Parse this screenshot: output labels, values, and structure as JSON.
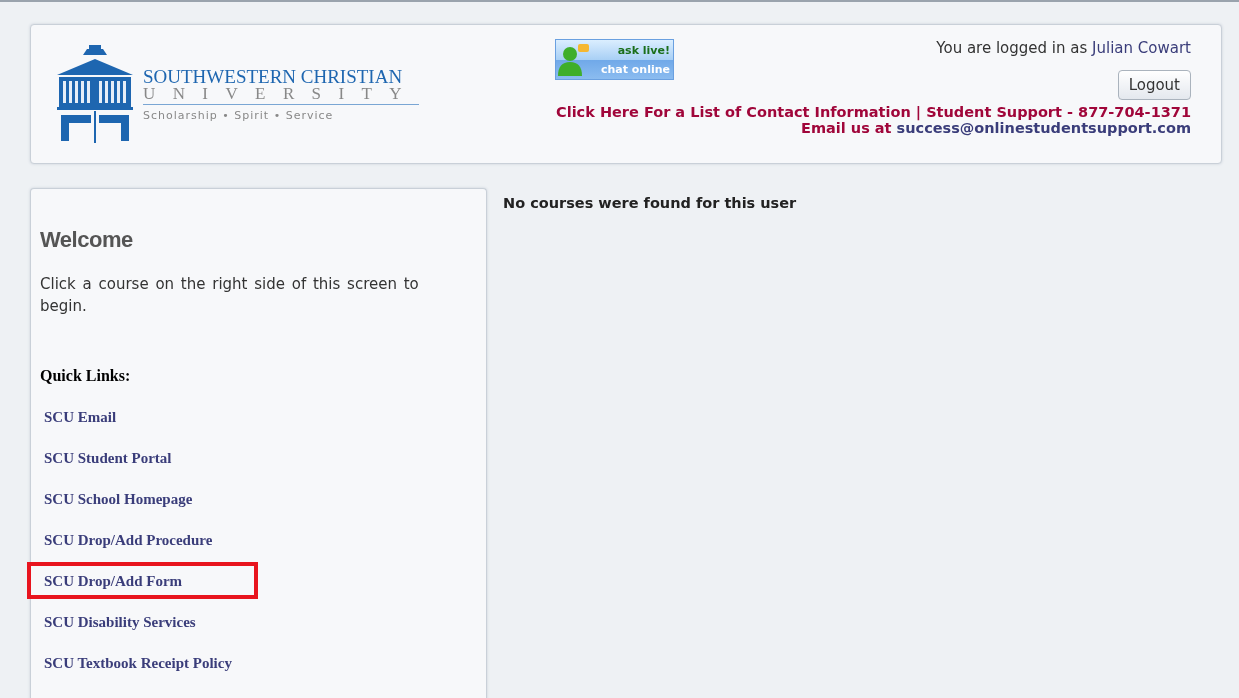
{
  "header": {
    "logo": {
      "name": "SOUTHWESTERN CHRISTIAN",
      "subname": "UNIVERSITY",
      "motto": "Scholarship • Spirit • Service"
    },
    "chat_badge": {
      "top": "ask live!",
      "bottom": "chat online"
    },
    "login": {
      "prefix": "You are logged in as",
      "user": "Julian Cowart"
    },
    "logout_button": "Logout",
    "contact_line": "Click Here For a List of Contact Information | Student Support - 877-704-1371",
    "email": {
      "prefix": "Email us at",
      "address": "success@onlinestudentsupport.com"
    }
  },
  "sidebar": {
    "title": "Welcome",
    "intro": "Click a course on the right side of this screen to begin.",
    "links_heading": "Quick Links:",
    "links": [
      {
        "label": "SCU Email",
        "highlighted": false
      },
      {
        "label": "SCU Student Portal",
        "highlighted": false
      },
      {
        "label": "SCU School Homepage",
        "highlighted": false
      },
      {
        "label": "SCU Drop/Add Procedure",
        "highlighted": false
      },
      {
        "label": "SCU Drop/Add Form",
        "highlighted": true
      },
      {
        "label": "SCU Disability Services",
        "highlighted": false
      },
      {
        "label": "SCU Textbook Receipt Policy",
        "highlighted": false
      }
    ]
  },
  "main": {
    "message": "No courses were found for this user"
  }
}
